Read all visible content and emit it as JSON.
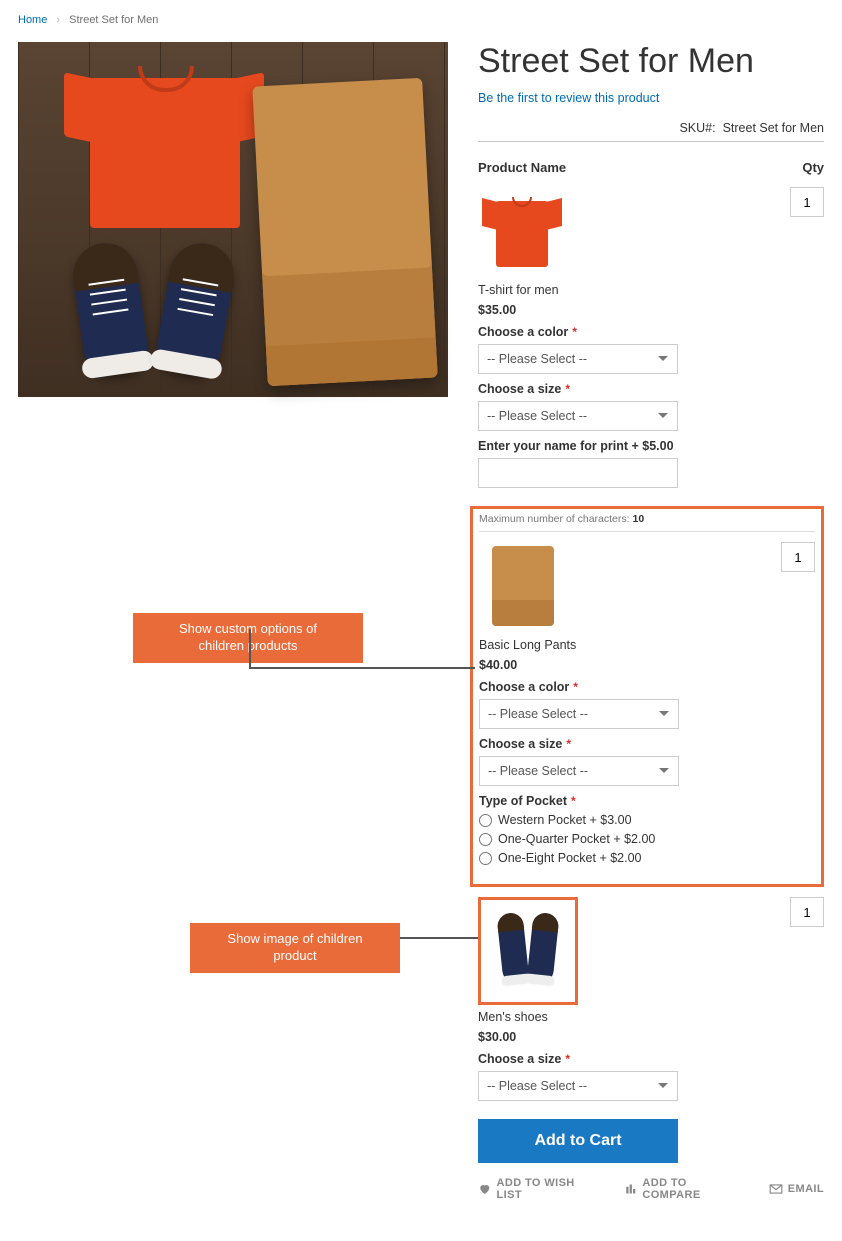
{
  "breadcrumbs": {
    "home": "Home",
    "current": "Street Set for Men"
  },
  "title": "Street Set for Men",
  "review_link": "Be the first to review this product",
  "sku_label": "SKU#:",
  "sku_value": "Street Set for Men",
  "table": {
    "name_header": "Product Name",
    "qty_header": "Qty"
  },
  "select_placeholder": "-- Please Select --",
  "children": {
    "tshirt": {
      "name": "T-shirt for men",
      "price": "$35.00",
      "qty": "1",
      "color_label": "Choose a color",
      "size_label": "Choose a size",
      "print_label": "Enter your name for print + $5.00",
      "maxchar_label": "Maximum number of characters:",
      "maxchar_value": "10"
    },
    "pants": {
      "name": "Basic Long Pants",
      "price": "$40.00",
      "qty": "1",
      "color_label": "Choose a color",
      "size_label": "Choose a size",
      "pocket_label": "Type of Pocket",
      "pocket_opts": {
        "a": "Western Pocket + $3.00",
        "b": "One-Quarter Pocket + $2.00",
        "c": "One-Eight Pocket + $2.00"
      }
    },
    "shoes": {
      "name": "Men's shoes",
      "price": "$30.00",
      "qty": "1",
      "size_label": "Choose a size"
    }
  },
  "add_to_cart": "Add to Cart",
  "actions": {
    "wishlist": "ADD TO WISH LIST",
    "compare": "ADD TO COMPARE",
    "email": "EMAIL"
  },
  "callouts": {
    "options": "Show custom options of\nchildren products",
    "image": "Show image of children product"
  }
}
